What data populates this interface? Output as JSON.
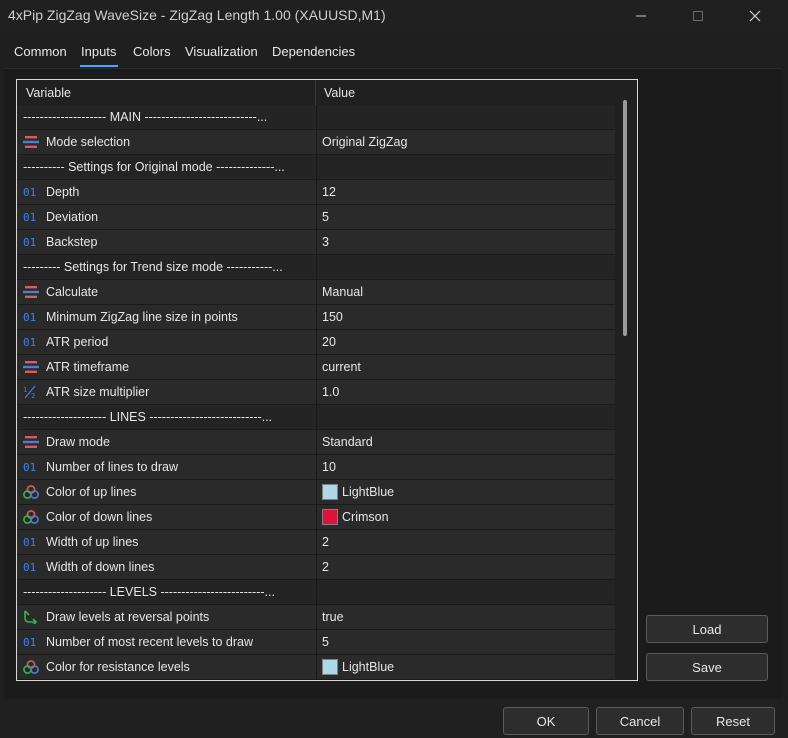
{
  "window": {
    "title": "4xPip ZigZag WaveSize - ZigZag Length 1.00 (XAUUSD,M1)"
  },
  "tabs": [
    {
      "label": "Common"
    },
    {
      "label": "Inputs"
    },
    {
      "label": "Colors"
    },
    {
      "label": "Visualization"
    },
    {
      "label": "Dependencies"
    }
  ],
  "active_tab": "Inputs",
  "grid": {
    "headers": {
      "variable": "Variable",
      "value": "Value"
    },
    "rows": [
      {
        "type": "separator",
        "label": "-------------------- MAIN ---------------------------...",
        "value": ""
      },
      {
        "type": "enum",
        "icon": "enum-icon",
        "label": "Mode selection",
        "value": "Original ZigZag"
      },
      {
        "type": "separator",
        "label": "---------- Settings for Original mode --------------...",
        "value": ""
      },
      {
        "type": "int",
        "icon": "int-icon",
        "label": "Depth",
        "value": "12"
      },
      {
        "type": "int",
        "icon": "int-icon",
        "label": "Deviation",
        "value": "5"
      },
      {
        "type": "int",
        "icon": "int-icon",
        "label": "Backstep",
        "value": "3"
      },
      {
        "type": "separator",
        "label": "--------- Settings for Trend size mode -----------...",
        "value": ""
      },
      {
        "type": "enum",
        "icon": "enum-icon",
        "label": "Calculate",
        "value": "Manual"
      },
      {
        "type": "int",
        "icon": "int-icon",
        "label": "Minimum ZigZag line size in points",
        "value": "150"
      },
      {
        "type": "int",
        "icon": "int-icon",
        "label": "ATR period",
        "value": "20"
      },
      {
        "type": "enum",
        "icon": "enum-icon",
        "label": "ATR timeframe",
        "value": "current"
      },
      {
        "type": "double",
        "icon": "fraction-icon",
        "label": "ATR size multiplier",
        "value": "1.0"
      },
      {
        "type": "separator",
        "label": "-------------------- LINES ---------------------------...",
        "value": ""
      },
      {
        "type": "enum",
        "icon": "enum-icon",
        "label": "Draw mode",
        "value": "Standard"
      },
      {
        "type": "int",
        "icon": "int-icon",
        "label": "Number of lines to draw",
        "value": "10"
      },
      {
        "type": "color",
        "icon": "color-icon",
        "label": "Color of up lines",
        "value": "LightBlue",
        "swatch": "#add8e6"
      },
      {
        "type": "color",
        "icon": "color-icon",
        "label": "Color of down lines",
        "value": "Crimson",
        "swatch": "#dc143c"
      },
      {
        "type": "int",
        "icon": "int-icon",
        "label": "Width of up lines",
        "value": "2"
      },
      {
        "type": "int",
        "icon": "int-icon",
        "label": "Width of down lines",
        "value": "2"
      },
      {
        "type": "separator",
        "label": "-------------------- LEVELS -------------------------...",
        "value": ""
      },
      {
        "type": "bool",
        "icon": "bool-arrow-icon",
        "label": "Draw levels at reversal points",
        "value": "true"
      },
      {
        "type": "int",
        "icon": "int-icon",
        "label": "Number of most recent levels to draw",
        "value": "5"
      },
      {
        "type": "color",
        "icon": "color-icon",
        "label": "Color for resistance levels",
        "value": "LightBlue",
        "swatch": "#add8e6"
      }
    ]
  },
  "side_buttons": {
    "load": "Load",
    "save": "Save"
  },
  "footer_buttons": {
    "ok": "OK",
    "cancel": "Cancel",
    "reset": "Reset"
  },
  "colors": {
    "accent": "#4ca6ff",
    "int_icon": "#3b82f6",
    "enum_icon_red": "#e05a5a",
    "enum_icon_blue": "#4a7fd4",
    "bool_icon": "#39b54a"
  }
}
